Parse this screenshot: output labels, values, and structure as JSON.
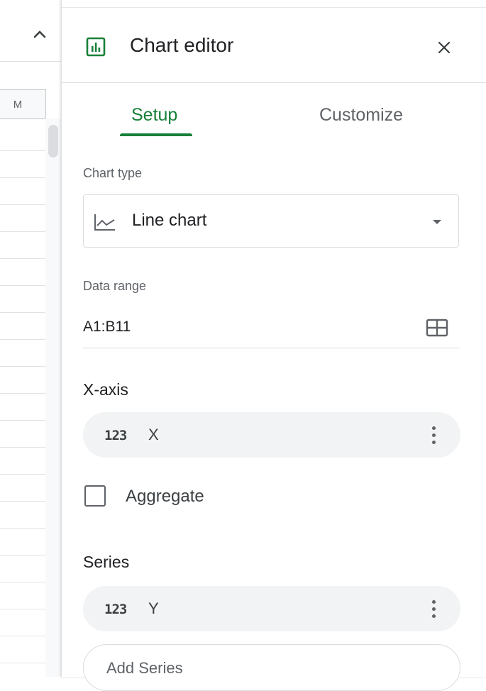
{
  "sheet": {
    "column_letter": "M"
  },
  "editor": {
    "title": "Chart editor",
    "tabs": [
      {
        "label": "Setup",
        "active": true
      },
      {
        "label": "Customize",
        "active": false
      }
    ],
    "chart_type": {
      "label": "Chart type",
      "value": "Line chart",
      "icon": "line-chart-icon"
    },
    "data_range": {
      "label": "Data range",
      "value": "A1:B11",
      "icon": "grid-select-icon"
    },
    "x_axis": {
      "title": "X-axis",
      "type_badge": "123",
      "field": "X"
    },
    "aggregate": {
      "label": "Aggregate",
      "checked": false
    },
    "series": {
      "title": "Series",
      "type_badge": "123",
      "field": "Y",
      "add_label": "Add Series"
    }
  },
  "colors": {
    "accent": "#188038",
    "chip_bg": "#f1f3f4",
    "border": "#dadce0",
    "muted_text": "#5f6368"
  }
}
